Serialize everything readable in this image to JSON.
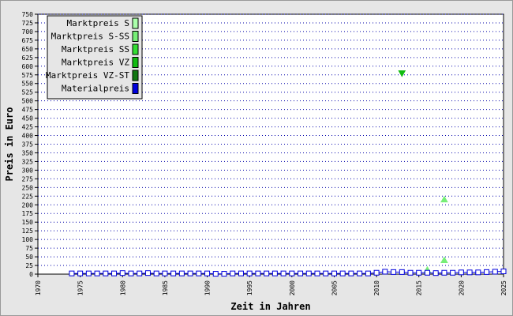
{
  "chart_data": {
    "type": "scatter",
    "title": "",
    "xlabel": "Zeit in Jahren",
    "ylabel": "Preis in Euro",
    "xlim": [
      1970,
      2025
    ],
    "ylim": [
      0,
      750
    ],
    "xticks": [
      1970,
      1975,
      1980,
      1985,
      1990,
      1995,
      2000,
      2005,
      2010,
      2015,
      2020,
      2025
    ],
    "yticks": [
      0,
      25,
      50,
      75,
      100,
      125,
      150,
      175,
      200,
      225,
      250,
      275,
      300,
      325,
      350,
      375,
      400,
      425,
      450,
      475,
      500,
      525,
      550,
      575,
      600,
      625,
      650,
      675,
      700,
      725,
      750
    ],
    "grid": "horizontal-dotted",
    "legend_position": "top-left",
    "series": [
      {
        "name": "Marktpreis S",
        "color": "#aaffaa",
        "marker": "none",
        "points": []
      },
      {
        "name": "Marktpreis S-SS",
        "color": "#77ee77",
        "marker": "triangle-up",
        "points": [
          [
            2016,
            12
          ],
          [
            2018,
            40
          ],
          [
            2018,
            215
          ]
        ]
      },
      {
        "name": "Marktpreis SS",
        "color": "#33dd33",
        "marker": "none",
        "points": []
      },
      {
        "name": "Marktpreis VZ",
        "color": "#11bb11",
        "marker": "triangle-down",
        "points": [
          [
            2013,
            580
          ]
        ]
      },
      {
        "name": "Marktpreis VZ-ST",
        "color": "#117711",
        "marker": "none",
        "points": []
      },
      {
        "name": "Materialpreis",
        "color": "#0000dd",
        "marker": "square-line",
        "points": [
          [
            1974,
            2
          ],
          [
            1975,
            2
          ],
          [
            1976,
            2
          ],
          [
            1977,
            2
          ],
          [
            1978,
            2
          ],
          [
            1979,
            2
          ],
          [
            1980,
            3
          ],
          [
            1981,
            2
          ],
          [
            1982,
            2
          ],
          [
            1983,
            3
          ],
          [
            1984,
            2
          ],
          [
            1985,
            2
          ],
          [
            1986,
            2
          ],
          [
            1987,
            2
          ],
          [
            1988,
            2
          ],
          [
            1989,
            2
          ],
          [
            1990,
            2
          ],
          [
            1991,
            1
          ],
          [
            1992,
            1
          ],
          [
            1993,
            2
          ],
          [
            1994,
            2
          ],
          [
            1995,
            2
          ],
          [
            1996,
            2
          ],
          [
            1997,
            2
          ],
          [
            1998,
            2
          ],
          [
            1999,
            2
          ],
          [
            2000,
            2
          ],
          [
            2001,
            2
          ],
          [
            2002,
            2
          ],
          [
            2003,
            2
          ],
          [
            2004,
            2
          ],
          [
            2005,
            2
          ],
          [
            2006,
            2
          ],
          [
            2007,
            2
          ],
          [
            2008,
            2
          ],
          [
            2009,
            2
          ],
          [
            2010,
            4
          ],
          [
            2011,
            7
          ],
          [
            2012,
            6
          ],
          [
            2013,
            6
          ],
          [
            2014,
            4
          ],
          [
            2015,
            4
          ],
          [
            2016,
            4
          ],
          [
            2017,
            3
          ],
          [
            2018,
            4
          ],
          [
            2019,
            4
          ],
          [
            2020,
            5
          ],
          [
            2021,
            5
          ],
          [
            2022,
            5
          ],
          [
            2023,
            6
          ],
          [
            2024,
            7
          ],
          [
            2025,
            8
          ]
        ]
      }
    ]
  }
}
